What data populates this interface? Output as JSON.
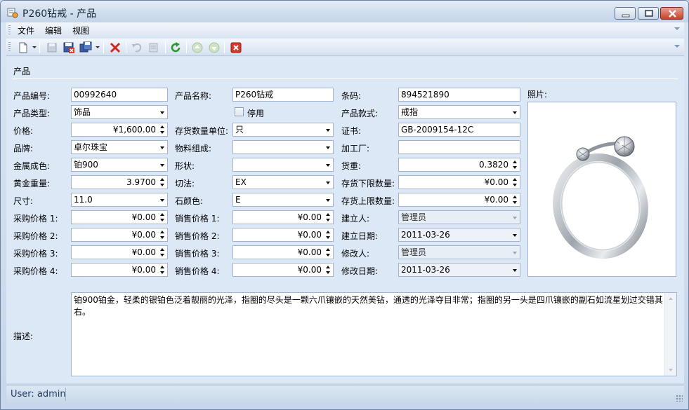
{
  "window": {
    "title": "P260钻戒 - 产品"
  },
  "menu": [
    "文件",
    "编辑",
    "视图"
  ],
  "toolbar": {
    "icons": [
      "new-document-icon",
      "save-icon",
      "save-close-icon",
      "save-copy-icon",
      "delete-icon",
      "undo-icon",
      "disabled-edit-icon",
      "refresh-icon",
      "previous-record-icon",
      "next-record-icon",
      "close-form-icon"
    ]
  },
  "section": {
    "title": "产品"
  },
  "form": {
    "code_label": "产品编号:",
    "code": "00992640",
    "name_label": "产品名称:",
    "name": "P260钻戒",
    "barcode_label": "条码:",
    "barcode": "894521890",
    "photo_label": "照片:",
    "type_label": "产品类型:",
    "type": "饰品",
    "disabled_label": "停用",
    "style_label": "产品款式:",
    "style": "戒指",
    "price_label": "价格:",
    "price": "¥1,600.00",
    "unit_label": "存货数量单位:",
    "unit": "只",
    "cert_label": "证书:",
    "cert": "GB-2009154-12C",
    "brand_label": "品牌:",
    "brand": "卓尔珠宝",
    "material_label": "物料组成:",
    "material": "",
    "factory_label": "加工厂:",
    "factory": "",
    "metal_label": "金属成色:",
    "metal": "铂900",
    "shape_label": "形状:",
    "shape": "",
    "weight_label": "货重:",
    "weight": "0.3820",
    "gold_label": "黄金重量:",
    "gold": "3.9700",
    "cut_label": "切法:",
    "cut": "EX",
    "min_stock_label": "存货下限数量:",
    "min_stock": "¥0.00",
    "size_label": "尺寸:",
    "size": "11.0",
    "color_label": "石颜色:",
    "color": "E",
    "max_stock_label": "存货上限数量:",
    "max_stock": "¥0.00",
    "purchase": [
      {
        "label": "采购价格 1:",
        "value": "¥0.00"
      },
      {
        "label": "采购价格 2:",
        "value": "¥0.00"
      },
      {
        "label": "采购价格 3:",
        "value": "¥0.00"
      },
      {
        "label": "采购价格 4:",
        "value": "¥0.00"
      }
    ],
    "sales": [
      {
        "label": "销售价格 1:",
        "value": "¥0.00"
      },
      {
        "label": "销售价格 2:",
        "value": "¥0.00"
      },
      {
        "label": "销售价格 3:",
        "value": "¥0.00"
      },
      {
        "label": "销售价格 4:",
        "value": "¥0.00"
      }
    ],
    "creator_label": "建立人:",
    "creator": "管理员",
    "created_label": "建立日期:",
    "created": "2011-03-26",
    "modifier_label": "修改人:",
    "modifier": "管理员",
    "modified_label": "修改日期:",
    "modified": "2011-03-26",
    "desc_label": "描述:",
    "desc": "铂900铂金，轻柔的银铂色泛着靓丽的光泽，指圈的尽头是一颗六爪镶嵌的天然美钻，通透的光泽夺目非常；指圈的另一头是四爪镶嵌的副石如流星划过交错其右。"
  },
  "status": {
    "user": "User: admin"
  },
  "colors": {
    "accent": "#c8402a",
    "panel": "#dde8f6",
    "border": "#a2b5cf"
  }
}
